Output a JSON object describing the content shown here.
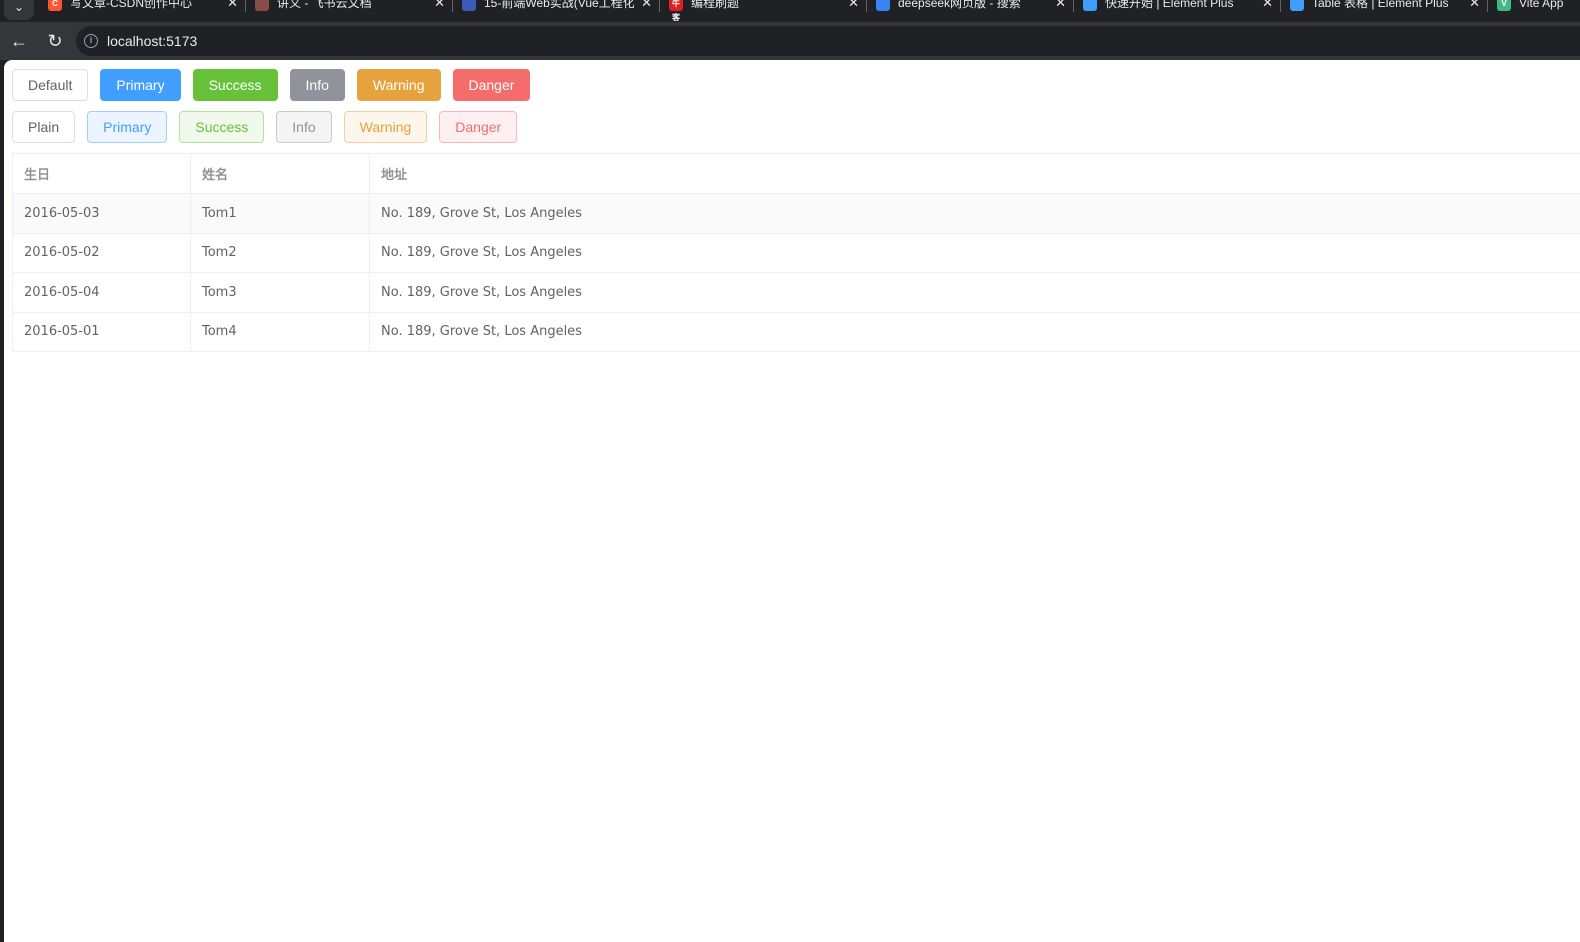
{
  "browser": {
    "tabs": [
      {
        "title": "写文章-CSDN创作中心",
        "favicon_color": "#fc5531",
        "favicon_glyph": "C"
      },
      {
        "title": "讲义 - 飞书云文档",
        "favicon_color": "#8a4b4b",
        "favicon_glyph": ""
      },
      {
        "title": "15-前端Web实战(Vue工程化",
        "favicon_color": "#3b5cb8",
        "favicon_glyph": ""
      },
      {
        "title": "编程刷题",
        "favicon_color": "#e02020",
        "favicon_glyph": "牛客"
      },
      {
        "title": "deepseek网页版 - 搜索",
        "favicon_color": "#3b82f6",
        "favicon_glyph": ""
      },
      {
        "title": "快速开始 | Element Plus",
        "favicon_color": "#409eff",
        "favicon_glyph": ""
      },
      {
        "title": "Table 表格 | Element Plus",
        "favicon_color": "#409eff",
        "favicon_glyph": ""
      },
      {
        "title": "Vite App",
        "favicon_color": "#42b883",
        "favicon_glyph": "V"
      }
    ],
    "url": "localhost:5173"
  },
  "buttons_solid": [
    {
      "label": "Default",
      "type": "default"
    },
    {
      "label": "Primary",
      "type": "primary"
    },
    {
      "label": "Success",
      "type": "success"
    },
    {
      "label": "Info",
      "type": "info"
    },
    {
      "label": "Warning",
      "type": "warning"
    },
    {
      "label": "Danger",
      "type": "danger"
    }
  ],
  "buttons_plain": [
    {
      "label": "Plain",
      "type": "default"
    },
    {
      "label": "Primary",
      "type": "primary"
    },
    {
      "label": "Success",
      "type": "success"
    },
    {
      "label": "Info",
      "type": "info"
    },
    {
      "label": "Warning",
      "type": "warning"
    },
    {
      "label": "Danger",
      "type": "danger"
    }
  ],
  "table": {
    "headers": [
      "生日",
      "姓名",
      "地址"
    ],
    "rows": [
      [
        "2016-05-03",
        "Tom1",
        "No. 189, Grove St, Los Angeles"
      ],
      [
        "2016-05-02",
        "Tom2",
        "No. 189, Grove St, Los Angeles"
      ],
      [
        "2016-05-04",
        "Tom3",
        "No. 189, Grove St, Los Angeles"
      ],
      [
        "2016-05-01",
        "Tom4",
        "No. 189, Grove St, Los Angeles"
      ]
    ]
  },
  "colors": {
    "primary": "#409eff",
    "success": "#67c23a",
    "info": "#909399",
    "warning": "#e6a23c",
    "danger": "#f56c6c"
  }
}
